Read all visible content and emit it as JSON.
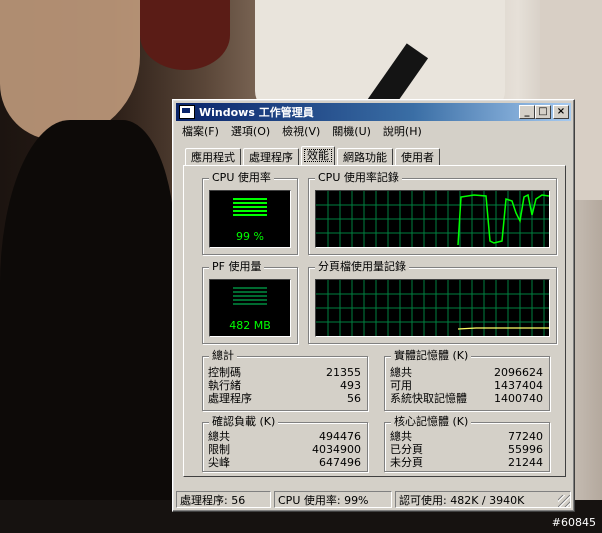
{
  "window": {
    "title": "Windows 工作管理員",
    "controls": {
      "minimize": "_",
      "maximize": "□",
      "close": "×"
    }
  },
  "menu": [
    "檔案(F)",
    "選項(O)",
    "檢視(V)",
    "關機(U)",
    "說明(H)"
  ],
  "tabs": [
    "應用程式",
    "處理程序",
    "效能",
    "網路功能",
    "使用者"
  ],
  "active_tab": "效能",
  "cpu_usage": {
    "label": "CPU 使用率",
    "value": "99 %",
    "percent": 99
  },
  "cpu_history": {
    "label": "CPU 使用率記錄"
  },
  "pf_usage": {
    "label": "PF 使用量",
    "value": "482 MB"
  },
  "pf_history": {
    "label": "分頁檔使用量記錄"
  },
  "totals": {
    "title": "總計",
    "rows": [
      {
        "label": "控制碼",
        "value": "21355"
      },
      {
        "label": "執行緒",
        "value": "493"
      },
      {
        "label": "處理程序",
        "value": "56"
      }
    ]
  },
  "physical_memory": {
    "title": "實體記憶體 (K)",
    "rows": [
      {
        "label": "總共",
        "value": "2096624"
      },
      {
        "label": "可用",
        "value": "1437404"
      },
      {
        "label": "系統快取記憶體",
        "value": "1400740"
      }
    ]
  },
  "commit_charge": {
    "title": "確認負載 (K)",
    "rows": [
      {
        "label": "總共",
        "value": "494476"
      },
      {
        "label": "限制",
        "value": "4034900"
      },
      {
        "label": "尖峰",
        "value": "647496"
      }
    ]
  },
  "kernel_memory": {
    "title": "核心記憶體 (K)",
    "rows": [
      {
        "label": "總共",
        "value": "77240"
      },
      {
        "label": "已分頁",
        "value": "55996"
      },
      {
        "label": "未分頁",
        "value": "21244"
      }
    ]
  },
  "statusbar": {
    "processes": "處理程序: 56",
    "cpu": "CPU 使用率: 99%",
    "commit": "認可使用: 482K / 3940K"
  },
  "watermark": "#60845",
  "colors": {
    "meter_green": "#00ff00",
    "grid_green": "#008040",
    "titlebar": "#0a246a"
  }
}
